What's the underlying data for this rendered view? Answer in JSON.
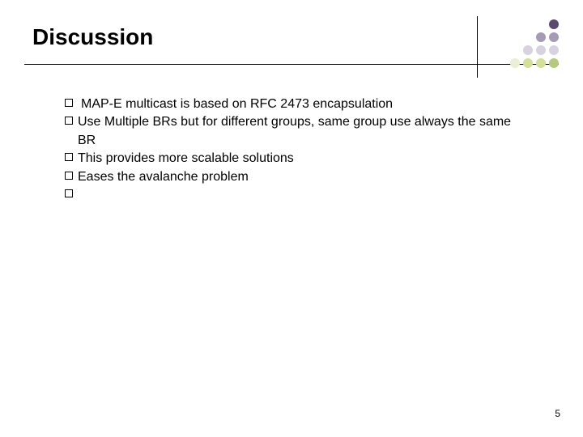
{
  "title": "Discussion",
  "bullets": {
    "b1": "MAP-E multicast is based on RFC 2473 encapsulation",
    "b2": "Use Multiple BRs but for different groups, same group use always the same BR",
    "b3": "This provides more scalable solutions",
    "b4": "Eases the avalanche problem",
    "b5": ""
  },
  "page_number": "5"
}
